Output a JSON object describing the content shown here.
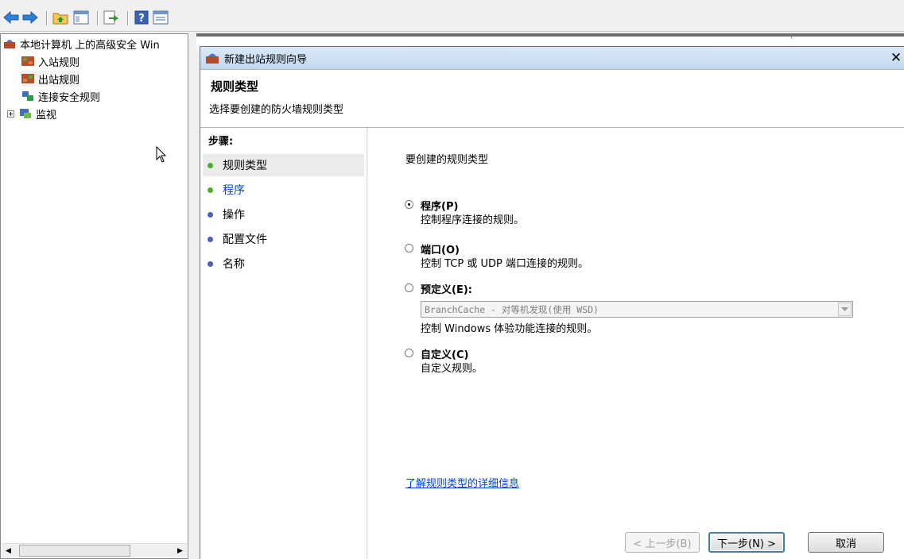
{
  "toolbar": {
    "icons": [
      "back-arrow-icon",
      "forward-arrow-icon",
      "folder-up-icon",
      "show-hide-tree-icon",
      "export-list-icon",
      "help-icon",
      "properties-icon"
    ]
  },
  "tree": {
    "root_label": "本地计算机 上的高级安全 Win",
    "items": [
      {
        "label": "入站规则",
        "icon": "inbound-rules-icon"
      },
      {
        "label": "出站规则",
        "icon": "outbound-rules-icon"
      },
      {
        "label": "连接安全规则",
        "icon": "connection-security-icon"
      },
      {
        "label": "监视",
        "icon": "monitor-icon"
      }
    ]
  },
  "dialog": {
    "title": "新建出站规则向导",
    "close_glyph": "✕",
    "header_title": "规则类型",
    "header_subtitle": "选择要创建的防火墙规则类型",
    "steps_title": "步骤:",
    "steps": [
      "规则类型",
      "程序",
      "操作",
      "配置文件",
      "名称"
    ],
    "content_heading": "要创建的规则类型",
    "options": [
      {
        "label": "程序(P)",
        "desc": "控制程序连接的规则。",
        "selected": true
      },
      {
        "label": "端口(O)",
        "desc": "控制 TCP 或 UDP 端口连接的规则。",
        "selected": false
      },
      {
        "label": "预定义(E):",
        "desc": "",
        "selected": false
      },
      {
        "label": "自定义(C)",
        "desc": "自定义规则。",
        "selected": false
      }
    ],
    "predefined_value": "BranchCache - 对等机发现(使用 WSD)",
    "predefined_desc": "控制 Windows 体验功能连接的规则。",
    "learn_more": "了解规则类型的详细信息",
    "buttons": {
      "back": "< 上一步(B)",
      "next": "下一步(N) >",
      "cancel": "取消"
    }
  },
  "colors": {
    "link": "#0046d5",
    "titlebar": "#c2d8ef",
    "step_dot_done": "#4caf28",
    "step_dot_todo": "#4a5fc4"
  }
}
